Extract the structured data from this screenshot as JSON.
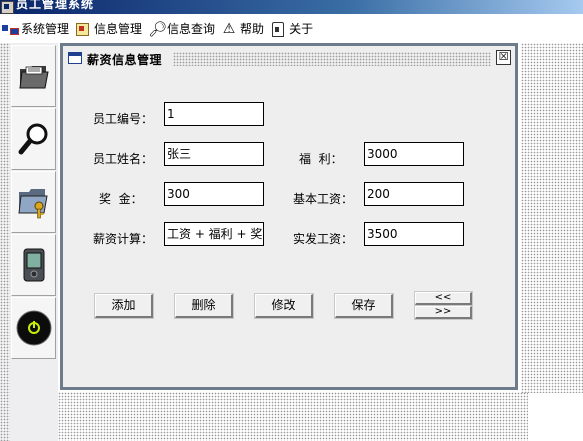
{
  "window": {
    "title": "员工管理系统"
  },
  "menu": {
    "items": [
      {
        "label": "系统管理",
        "icon": "system-icon"
      },
      {
        "label": "信息管理",
        "icon": "info-icon"
      },
      {
        "label": "信息查询",
        "icon": "search-icon"
      },
      {
        "label": "帮助",
        "icon": "help-icon"
      },
      {
        "label": "关于",
        "icon": "about-icon"
      }
    ]
  },
  "sidebar": {
    "buttons": [
      {
        "icon": "folder-icon"
      },
      {
        "icon": "magnifier-icon"
      },
      {
        "icon": "folder-key-icon"
      },
      {
        "icon": "pda-icon"
      },
      {
        "icon": "power-icon"
      }
    ]
  },
  "dialog": {
    "title": "薪资信息管理",
    "close_label": "☒",
    "fields": {
      "emp_id": {
        "label": "员工编号：",
        "value": "1"
      },
      "emp_name": {
        "label": "员工姓名：",
        "value": "张三"
      },
      "welfare": {
        "label": "福  利：",
        "value": "3000"
      },
      "bonus": {
        "label": "奖  金：",
        "value": "300"
      },
      "base_pay": {
        "label": "基本工资：",
        "value": "200"
      },
      "formula": {
        "label": "薪资计算：",
        "value": "工资 + 福利 + 奖金"
      },
      "net_pay": {
        "label": "实发工资：",
        "value": "3500"
      }
    },
    "buttons": {
      "add": "添加",
      "delete": "删除",
      "modify": "修改",
      "save": "保存",
      "prev": "<<",
      "next": ">>"
    }
  },
  "colors": {
    "frame_border": "#6e7b8b",
    "titlebar": "#0a246a",
    "panel_bg": "#eeeeee"
  }
}
